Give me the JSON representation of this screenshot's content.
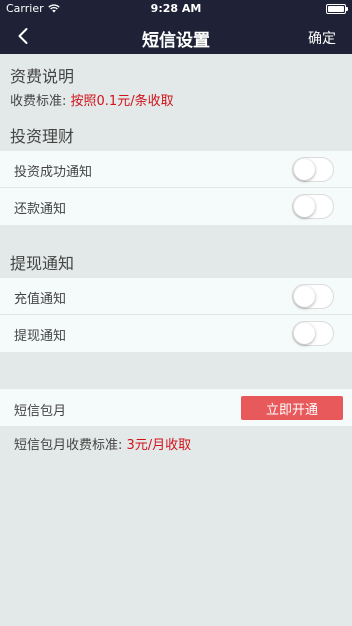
{
  "status_bar": {
    "carrier": "Carrier",
    "time": "9:28 AM"
  },
  "nav": {
    "back_icon": "chevron-left-icon",
    "title": "短信设置",
    "confirm": "确定"
  },
  "fee_section": {
    "title": "资费说明",
    "label": "收费标准:",
    "value": "按照0.1元/条收取"
  },
  "invest_section": {
    "title": "投资理财",
    "items": [
      {
        "label": "投资成功通知",
        "on": false
      },
      {
        "label": "还款通知",
        "on": false
      }
    ]
  },
  "withdraw_section": {
    "title": "提现通知",
    "items": [
      {
        "label": "充值通知",
        "on": false
      },
      {
        "label": "提现通知",
        "on": false
      }
    ]
  },
  "sms_package": {
    "label": "短信包月",
    "button": "立即开通",
    "fee_label": "短信包月收费标准:",
    "fee_value": "3元/月收取"
  },
  "colors": {
    "nav_bg": "#1f2236",
    "accent_red": "#d0121b",
    "button_red": "#e8595c",
    "page_bg": "#e3e9e8"
  }
}
